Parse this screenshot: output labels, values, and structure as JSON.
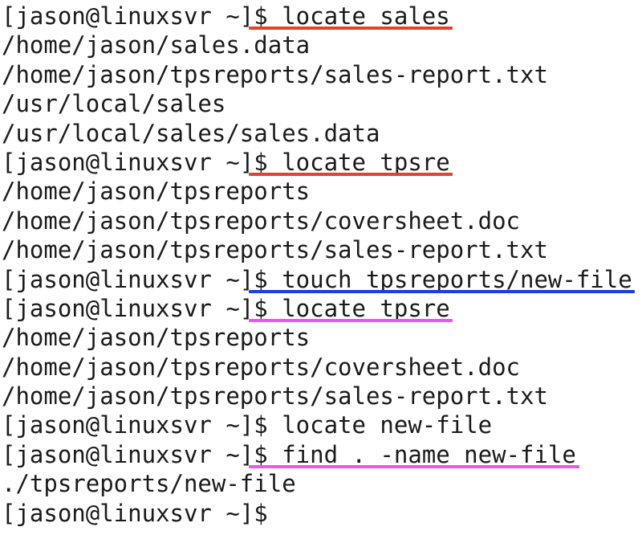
{
  "terminal": {
    "lines": [
      {
        "kind": "command",
        "prompt": "[jason@linuxsvr ~]",
        "cmd": "$ locate sales",
        "highlight": "red"
      },
      {
        "kind": "output",
        "text": "/home/jason/sales.data"
      },
      {
        "kind": "output",
        "text": "/home/jason/tpsreports/sales-report.txt"
      },
      {
        "kind": "output",
        "text": "/usr/local/sales"
      },
      {
        "kind": "output",
        "text": "/usr/local/sales/sales.data"
      },
      {
        "kind": "command",
        "prompt": "[jason@linuxsvr ~]",
        "cmd": "$ locate tpsre",
        "highlight": "red"
      },
      {
        "kind": "output",
        "text": "/home/jason/tpsreports"
      },
      {
        "kind": "output",
        "text": "/home/jason/tpsreports/coversheet.doc"
      },
      {
        "kind": "output",
        "text": "/home/jason/tpsreports/sales-report.txt"
      },
      {
        "kind": "command",
        "prompt": "[jason@linuxsvr ~]",
        "cmd": "$ touch tpsreports/new-file",
        "highlight": "blue"
      },
      {
        "kind": "command",
        "prompt": "[jason@linuxsvr ~]",
        "cmd": "$ locate tpsre",
        "highlight": "magenta"
      },
      {
        "kind": "output",
        "text": "/home/jason/tpsreports"
      },
      {
        "kind": "output",
        "text": "/home/jason/tpsreports/coversheet.doc"
      },
      {
        "kind": "output",
        "text": "/home/jason/tpsreports/sales-report.txt"
      },
      {
        "kind": "command",
        "prompt": "[jason@linuxsvr ~]",
        "cmd": "$ locate new-file",
        "highlight": null
      },
      {
        "kind": "command",
        "prompt": "[jason@linuxsvr ~]",
        "cmd": "$ find . -name new-file",
        "highlight": "magenta"
      },
      {
        "kind": "output",
        "text": "./tpsreports/new-file"
      },
      {
        "kind": "command",
        "prompt": "[jason@linuxsvr ~]",
        "cmd": "$",
        "highlight": null
      }
    ]
  },
  "colors": {
    "red": "#e8402a",
    "blue": "#1b3ee0",
    "magenta": "#ee55ee",
    "text": "#1a1a1a",
    "background": "#ffffff"
  }
}
